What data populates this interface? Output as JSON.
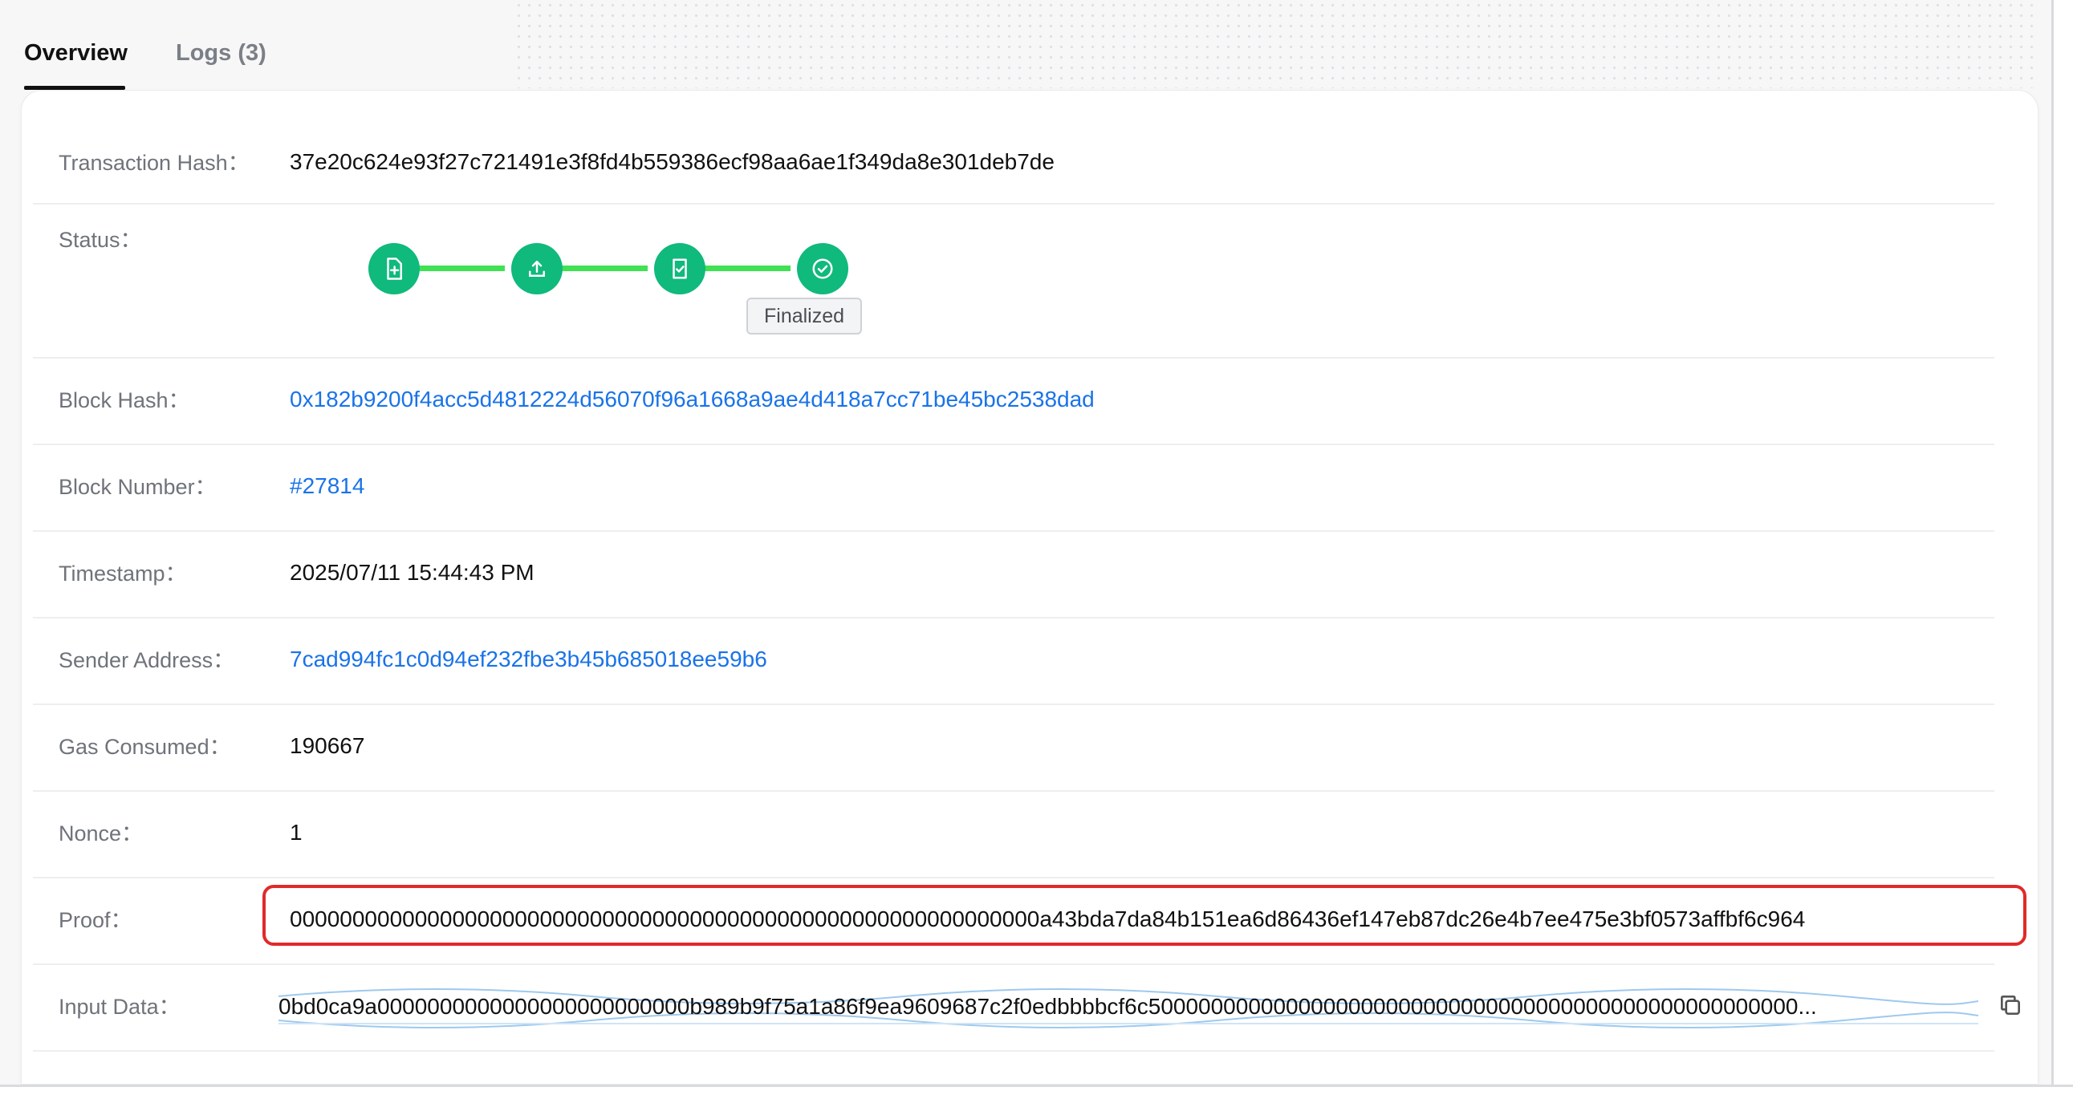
{
  "tabs": [
    {
      "label": "Overview",
      "active": true
    },
    {
      "label": "Logs (3)",
      "active": false
    }
  ],
  "details": {
    "transaction_hash": {
      "label": "Transaction Hash：",
      "value": "37e20c624e93f27c721491e3f8fd4b559386ecf98aa6ae1f349da8e301deb7de"
    },
    "status": {
      "label": "Status：",
      "steps": [
        "file-add-icon",
        "upload-icon",
        "file-check-icon",
        "check-circle-icon"
      ],
      "current_label": "Finalized",
      "active_color": "#10b97c",
      "line_color": "#3ee253"
    },
    "block_hash": {
      "label": "Block Hash：",
      "value": "0x182b9200f4acc5d4812224d56070f96a1668a9ae4d418a7cc71be45bc2538dad"
    },
    "block_number": {
      "label": "Block Number：",
      "value": "#27814"
    },
    "timestamp": {
      "label": "Timestamp：",
      "value": "2025/07/11 15:44:43 PM"
    },
    "sender_address": {
      "label": "Sender Address：",
      "value": "7cad994fc1c0d94ef232fbe3b45b685018ee59b6"
    },
    "gas_consumed": {
      "label": "Gas Consumed：",
      "value": "190667"
    },
    "nonce": {
      "label": "Nonce：",
      "value": "1"
    },
    "proof": {
      "label": "Proof：",
      "value": "000000000000000000000000000000000000000000000000000000000000a43bda7da84b151ea6d86436ef147eb87dc26e4b7ee475e3bf0573affbf6c964"
    },
    "input_data": {
      "label": "Input Data：",
      "value": "0bd0ca9a0000000000000000000000000b989b9f75a1a86f9ea9609687c2f0edbbbbcf6c5000000000000000000000000000000000000000000000000000..."
    }
  },
  "colors": {
    "link": "#1a73e8",
    "highlight_border": "#e02a2a"
  }
}
